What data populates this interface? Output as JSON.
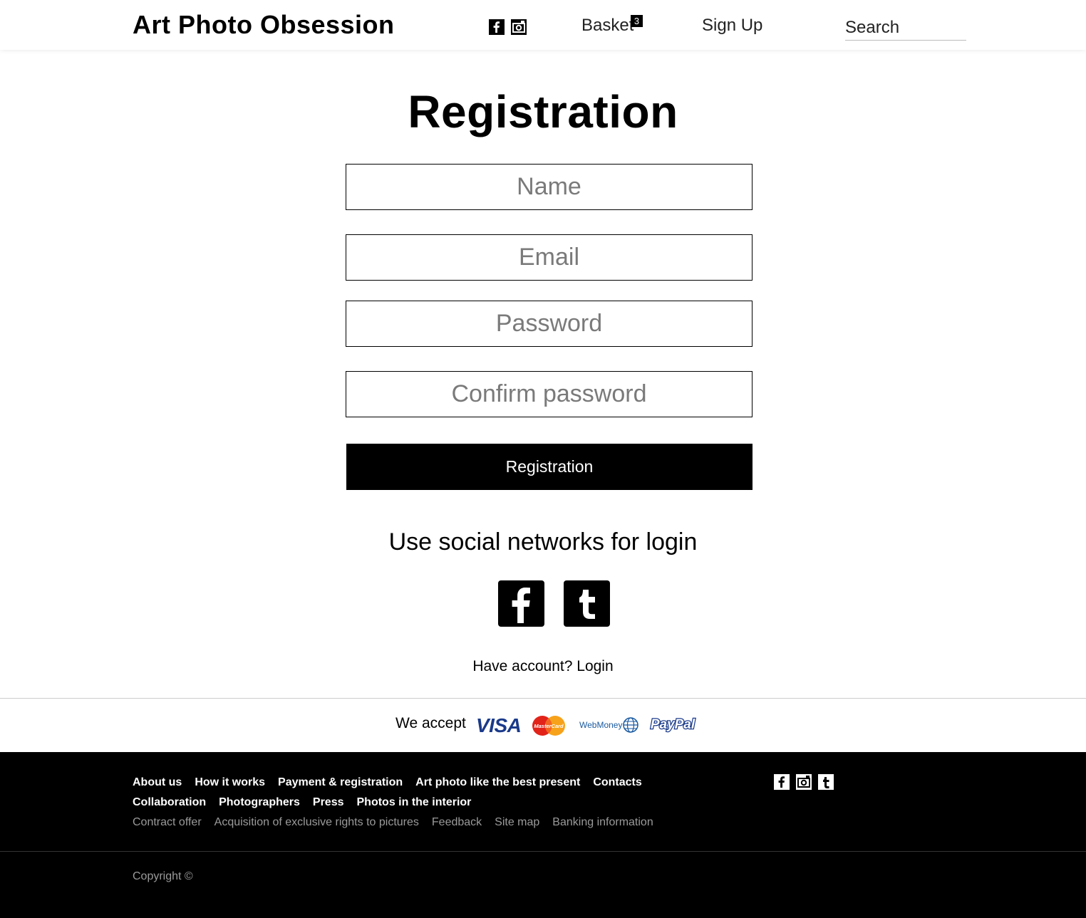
{
  "header": {
    "logo": "Art Photo Obsession",
    "social_icons": [
      "facebook-icon",
      "instagram-icon"
    ],
    "nav": {
      "basket_label": "Basket",
      "basket_count": "3",
      "signup_label": "Sign Up"
    },
    "search_placeholder": "Search"
  },
  "main": {
    "title": "Registration",
    "fields": {
      "name_placeholder": "Name",
      "email_placeholder": "Email",
      "password_placeholder": "Password",
      "confirm_placeholder": "Confirm password"
    },
    "submit_label": "Registration",
    "social_title": "Use social networks for login",
    "social_buttons": [
      "facebook-icon",
      "tumblr-icon"
    ],
    "have_account_text": "Have account?",
    "login_label": "Login"
  },
  "payments": {
    "label": "We accept",
    "methods": {
      "visa": "VISA",
      "mastercard": "MasterCard",
      "webmoney": "WebMoney",
      "paypal": "PayPal"
    }
  },
  "footer": {
    "row1": [
      "About us",
      "How it works",
      "Payment & registration",
      "Art photo like the best present",
      "Contacts"
    ],
    "row2": [
      "Collaboration",
      "Photographers",
      "Press",
      "Photos in the interior"
    ],
    "row3": [
      "Contract offer",
      "Acquisition of exclusive rights to pictures",
      "Feedback",
      "Site map",
      "Banking information"
    ],
    "social_icons": [
      "facebook-icon",
      "instagram-icon",
      "tumblr-icon"
    ],
    "copyright": "Copyright ©"
  },
  "colors": {
    "accent": "#000000",
    "placeholder": "#7a7a7a",
    "footer_muted": "#9a9a9a"
  }
}
